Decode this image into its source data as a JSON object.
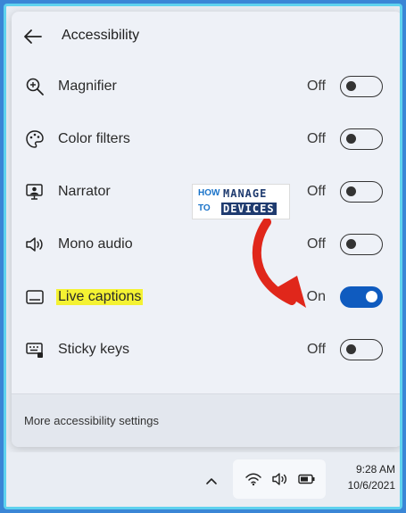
{
  "panel": {
    "title": "Accessibility",
    "back_icon": "arrow-left-icon",
    "items": [
      {
        "label": "Magnifier",
        "icon": "magnifier-icon",
        "state": "Off",
        "on": false
      },
      {
        "label": "Color filters",
        "icon": "color-filters-icon",
        "state": "Off",
        "on": false
      },
      {
        "label": "Narrator",
        "icon": "narrator-icon",
        "state": "Off",
        "on": false
      },
      {
        "label": "Mono audio",
        "icon": "mono-audio-icon",
        "state": "Off",
        "on": false
      },
      {
        "label": "Live captions",
        "icon": "live-captions-icon",
        "state": "On",
        "on": true,
        "highlight": "#f4f232"
      },
      {
        "label": "Sticky keys",
        "icon": "sticky-keys-icon",
        "state": "Off",
        "on": false
      }
    ],
    "footer_link": "More accessibility settings"
  },
  "watermark": {
    "how": "HOW",
    "to": "TO",
    "word1": "MANAGE",
    "word2": "DEVICES"
  },
  "taskbar": {
    "time": "9:28 AM",
    "date": "10/6/2021",
    "icons": [
      "chevron-up-icon",
      "wifi-icon",
      "volume-icon",
      "battery-icon"
    ]
  },
  "colors": {
    "accent": "#0f5bbf",
    "frame_border": "#5fd2ee",
    "background": "#3a86d6",
    "annotation_arrow": "#e0271b"
  }
}
